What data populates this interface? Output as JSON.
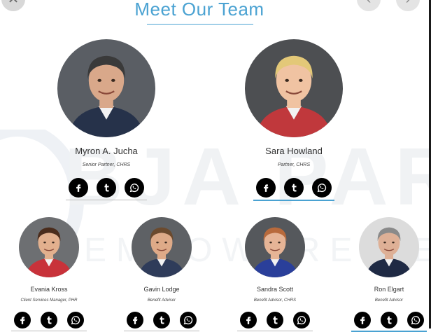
{
  "header": {
    "title": "Meet Our Team"
  },
  "controls": {
    "close_icon": "close-icon",
    "prev_icon": "chevron-left-icon",
    "next_icon": "chevron-right-icon"
  },
  "watermark": {
    "main": "BJA PARTNE",
    "sub": "EMPOWERE BENEFITS"
  },
  "colors": {
    "accent": "#4aa2d2",
    "social_bg": "#000000",
    "text": "#333333"
  },
  "team": [
    {
      "name": "Myron A. Jucha",
      "role": "Senior Partner, CHRS",
      "bg": "#5a5e64",
      "skin": "#d9a88a",
      "hair": "#3a3a3a",
      "shirt": "#26324a"
    },
    {
      "name": "Sara Howland",
      "role": "Partner, CHRS",
      "bg": "#4d4f52",
      "skin": "#f0c3a2",
      "hair": "#e3c878",
      "shirt": "#c0383c"
    },
    {
      "name": "Evania Kross",
      "role": "Client Services Manager, PHR",
      "bg": "#6d6f72",
      "skin": "#e2b08e",
      "hair": "#4a2c1c",
      "shirt": "#c8323a"
    },
    {
      "name": "Gavin Lodge",
      "role": "Benefit Advisor",
      "bg": "#5e6165",
      "skin": "#deaa88",
      "hair": "#6b4a2e",
      "shirt": "#2f3c5a"
    },
    {
      "name": "Sandra Scott",
      "role": "Benefit Advisor, CHRS",
      "bg": "#55585c",
      "skin": "#e6b496",
      "hair": "#b86a3c",
      "shirt": "#2a3f9a"
    },
    {
      "name": "Ron Elgart",
      "role": "Benefit Advisor",
      "bg": "#dcdcdc",
      "skin": "#deb096",
      "hair": "#8a8a8a",
      "shirt": "#1f2a44"
    }
  ],
  "social_icons": [
    "facebook-icon",
    "tumblr-icon",
    "whatsapp-icon"
  ]
}
